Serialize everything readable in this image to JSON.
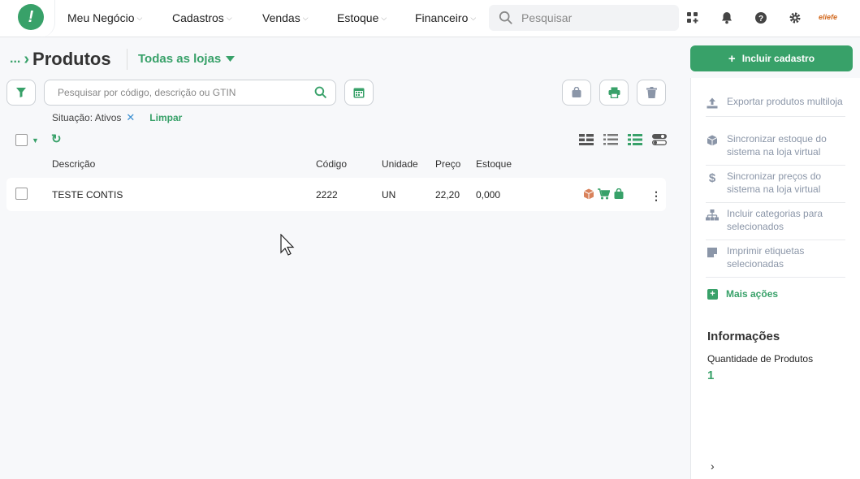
{
  "nav": {
    "items": [
      {
        "label": "Meu Negócio"
      },
      {
        "label": "Cadastros"
      },
      {
        "label": "Vendas"
      },
      {
        "label": "Estoque"
      },
      {
        "label": "Financeiro"
      }
    ],
    "search_placeholder": "Pesquisar",
    "brand": "eliefe"
  },
  "header": {
    "breadcrumb_dots": "...",
    "title": "Produtos",
    "store_selector": "Todas as lojas"
  },
  "toolbar": {
    "search_placeholder": "Pesquisar por código, descrição ou GTIN"
  },
  "filters": {
    "situacao": "Situação: Ativos",
    "clear_label": "Limpar"
  },
  "table": {
    "columns": [
      "Descrição",
      "Código",
      "Unidade",
      "Preço",
      "Estoque"
    ],
    "rows": [
      {
        "descricao": "TESTE CONTIS",
        "codigo": "2222",
        "unidade": "UN",
        "preco": "22,20",
        "estoque": "0,000"
      }
    ]
  },
  "sidebar": {
    "primary_button": "Incluir cadastro",
    "actions": [
      {
        "label": "Exportar produtos multiloja",
        "icon": "upload-icon"
      },
      {
        "label": "Sincronizar estoque do sistema na loja virtual",
        "icon": "box-icon"
      },
      {
        "label": "Sincronizar preços do sistema na loja virtual",
        "icon": "dollar-icon"
      },
      {
        "label": "Incluir categorias para selecionados",
        "icon": "hierarchy-icon"
      },
      {
        "label": "Imprimir etiquetas selecionadas",
        "icon": "label-icon"
      }
    ],
    "more_actions": "Mais ações",
    "info_title": "Informações",
    "info_label": "Quantidade de Produtos",
    "info_value": "1"
  },
  "colors": {
    "accent": "#38a169",
    "muted": "#8b96a8"
  }
}
